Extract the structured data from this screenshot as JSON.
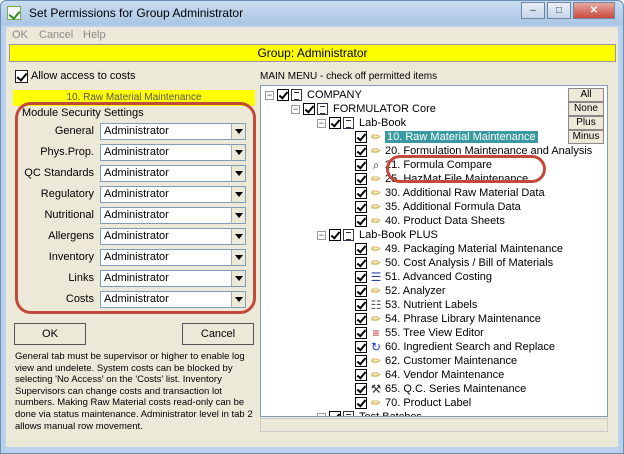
{
  "window": {
    "title": "Set Permissions for Group Administrator",
    "minimize_glyph": "–",
    "restore_glyph": "□",
    "close_glyph": "✕"
  },
  "menu": [
    "OK",
    "Cancel",
    "Help"
  ],
  "group_banner": "Group: Administrator",
  "allow_costs": {
    "label": "Allow access to costs",
    "checked": true
  },
  "selected_item_strip": "10. Raw Material Maintenance",
  "module_security": {
    "heading": "Module Security Settings",
    "fields": [
      {
        "label": "General",
        "value": "Administrator"
      },
      {
        "label": "Phys.Prop.",
        "value": "Administrator"
      },
      {
        "label": "QC Standards",
        "value": "Administrator"
      },
      {
        "label": "Regulatory",
        "value": "Administrator"
      },
      {
        "label": "Nutritional",
        "value": "Administrator"
      },
      {
        "label": "Allergens",
        "value": "Administrator"
      },
      {
        "label": "Inventory",
        "value": "Administrator"
      },
      {
        "label": "Links",
        "value": "Administrator"
      },
      {
        "label": "Costs",
        "value": "Administrator"
      }
    ]
  },
  "buttons": {
    "ok": "OK",
    "cancel": "Cancel"
  },
  "help_text": "General tab must be supervisor or higher to enable log view and undelete.  System costs can be blocked by selecting 'No Access' on the 'Costs' list.  Inventory Supervisors can change costs and transaction lot numbers.  Making Raw Material costs read-only can be done via status maintenance.  Administrator level in tab 2 allows manual row movement.",
  "main_menu": {
    "heading": "MAIN MENU - check off permitted items",
    "side_buttons": [
      "All",
      "None",
      "Plus",
      "Minus"
    ],
    "tree": [
      {
        "text": "COMPANY",
        "level": 0,
        "expander": "−",
        "icon": "doc"
      },
      {
        "text": "FORMULATOR Core",
        "level": 1,
        "expander": "−",
        "icon": "doc"
      },
      {
        "text": "Lab-Book",
        "level": 2,
        "expander": "−",
        "icon": "doc"
      },
      {
        "text": "10. Raw Material Maintenance",
        "level": 3,
        "icon": "pencil",
        "selected": true
      },
      {
        "text": "20. Formulation Maintenance and Analysis",
        "level": 3,
        "icon": "pencil"
      },
      {
        "text": "21. Formula Compare",
        "level": 3,
        "icon": "magnifier"
      },
      {
        "text": "25. HazMat File Maintenance",
        "level": 3,
        "icon": "pencil"
      },
      {
        "text": "30. Additional Raw Material Data",
        "level": 3,
        "icon": "pencil"
      },
      {
        "text": "35. Additional Formula Data",
        "level": 3,
        "icon": "pencil"
      },
      {
        "text": "40. Product Data Sheets",
        "level": 3,
        "icon": "pencil"
      },
      {
        "text": "Lab-Book PLUS",
        "level": 2,
        "expander": "−",
        "icon": "doc"
      },
      {
        "text": "49. Packaging Material Maintenance",
        "level": 3,
        "icon": "pencil"
      },
      {
        "text": "50. Cost Analysis / Bill of Materials",
        "level": 3,
        "icon": "pencil"
      },
      {
        "text": "51. Advanced Costing",
        "level": 3,
        "icon": "list"
      },
      {
        "text": "52. Analyzer",
        "level": 3,
        "icon": "pencil"
      },
      {
        "text": "53. Nutrient Labels",
        "level": 3,
        "icon": "label"
      },
      {
        "text": "54. Phrase Library Maintenance",
        "level": 3,
        "icon": "pencil"
      },
      {
        "text": "55. Tree View Editor",
        "level": 3,
        "icon": "tree"
      },
      {
        "text": "60. Ingredient Search and Replace",
        "level": 3,
        "icon": "replace"
      },
      {
        "text": "62. Customer Maintenance",
        "level": 3,
        "icon": "pencil"
      },
      {
        "text": "64. Vendor Maintenance",
        "level": 3,
        "icon": "pencil"
      },
      {
        "text": "65. Q.C. Series Maintenance",
        "level": 3,
        "icon": "wrench"
      },
      {
        "text": "70. Product Label",
        "level": 3,
        "icon": "pencil"
      },
      {
        "text": "Test Batches",
        "level": 2,
        "expander": "−",
        "icon": "doc"
      }
    ]
  },
  "colors": {
    "banner": "#ffff00",
    "highlight": "#3a9aa0",
    "annotation": "#c14a3a"
  }
}
